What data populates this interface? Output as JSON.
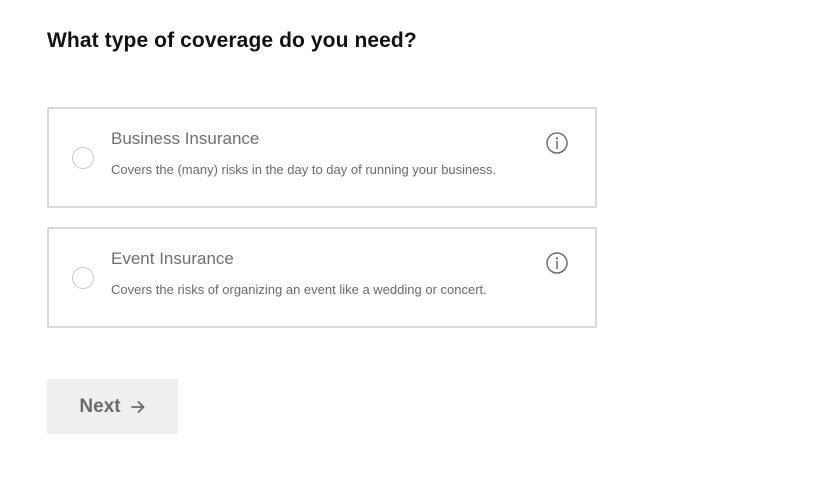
{
  "question": "What type of coverage do you need?",
  "options": [
    {
      "title": "Business Insurance",
      "description": "Covers the (many) risks in the day to day of running your business.",
      "icon": "info-icon",
      "selected": false
    },
    {
      "title": "Event Insurance",
      "description": "Covers the risks of organizing an event like a wedding or concert.",
      "icon": "info-icon",
      "selected": false
    }
  ],
  "next_button": {
    "label": "Next",
    "icon": "arrow-right-icon"
  },
  "colors": {
    "text_primary": "#111111",
    "text_muted": "#6f6f6f",
    "card_border": "#d9d9d9",
    "button_bg": "#efefef"
  }
}
